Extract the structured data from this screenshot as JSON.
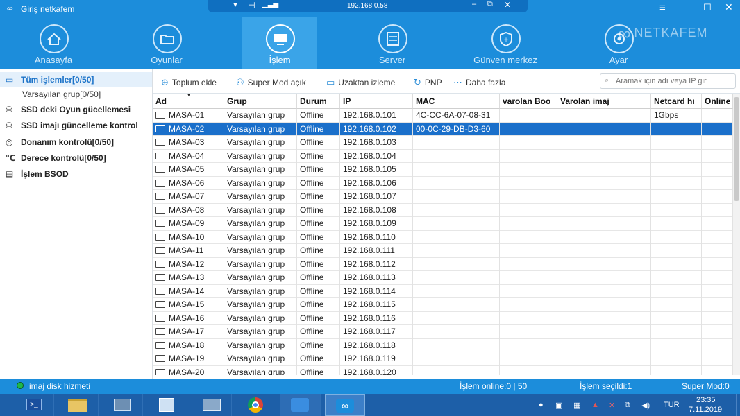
{
  "window": {
    "title": "Giriş netkafem",
    "ip_address": "192.168.0.58",
    "logo_text": "NETKAFEM"
  },
  "nav": [
    {
      "label": "Anasayfa",
      "icon": "home-icon"
    },
    {
      "label": "Oyunlar",
      "icon": "folder-icon"
    },
    {
      "label": "İşlem",
      "icon": "monitor-icon",
      "active": true
    },
    {
      "label": "Server",
      "icon": "server-icon"
    },
    {
      "label": "Günven merkez",
      "icon": "shield-icon"
    },
    {
      "label": "Ayar",
      "icon": "gear-icon"
    }
  ],
  "toolbar": {
    "add": "Toplum ekle",
    "super": "Super Mod açık",
    "remote": "Uzaktan izleme",
    "pnp": "PNP",
    "more": "Daha fazla",
    "search_placeholder": "Aramak için adı veya IP gir"
  },
  "sidebar": [
    {
      "label": "Tüm işlemler[0/50]",
      "icon": "monitor-icon"
    },
    {
      "label": "Varsayılan grup[0/50]"
    },
    {
      "label": "SSD deki Oyun gücellemesi",
      "icon": "ssd-icon"
    },
    {
      "label": "SSD imajı güncelleme kontrol",
      "icon": "ssd-icon"
    },
    {
      "label": "Donanım kontrolü[0/50]",
      "icon": "hardware-icon"
    },
    {
      "label": "Derece kontrolü[0/50]",
      "icon": "temperature-icon"
    },
    {
      "label": "İşlem BSOD",
      "icon": "bsod-icon"
    }
  ],
  "table": {
    "columns": [
      "Ad",
      "Grup",
      "Durum",
      "IP",
      "MAC",
      "varolan Boo",
      "Varolan imaj",
      "Netcard hı",
      "Online"
    ],
    "rows": [
      {
        "name": "MASA-01",
        "group": "Varsayılan grup",
        "status": "Offline",
        "ip": "192.168.0.101",
        "mac": "4C-CC-6A-07-08-31",
        "netcard": "1Gbps"
      },
      {
        "name": "MASA-02",
        "group": "Varsayılan grup",
        "status": "Offline",
        "ip": "192.168.0.102",
        "mac": "00-0C-29-DB-D3-60",
        "netcard": ""
      },
      {
        "name": "MASA-03",
        "group": "Varsayılan grup",
        "status": "Offline",
        "ip": "192.168.0.103",
        "mac": "",
        "netcard": ""
      },
      {
        "name": "MASA-04",
        "group": "Varsayılan grup",
        "status": "Offline",
        "ip": "192.168.0.104",
        "mac": "",
        "netcard": ""
      },
      {
        "name": "MASA-05",
        "group": "Varsayılan grup",
        "status": "Offline",
        "ip": "192.168.0.105",
        "mac": "",
        "netcard": ""
      },
      {
        "name": "MASA-06",
        "group": "Varsayılan grup",
        "status": "Offline",
        "ip": "192.168.0.106",
        "mac": "",
        "netcard": ""
      },
      {
        "name": "MASA-07",
        "group": "Varsayılan grup",
        "status": "Offline",
        "ip": "192.168.0.107",
        "mac": "",
        "netcard": ""
      },
      {
        "name": "MASA-08",
        "group": "Varsayılan grup",
        "status": "Offline",
        "ip": "192.168.0.108",
        "mac": "",
        "netcard": ""
      },
      {
        "name": "MASA-09",
        "group": "Varsayılan grup",
        "status": "Offline",
        "ip": "192.168.0.109",
        "mac": "",
        "netcard": ""
      },
      {
        "name": "MASA-10",
        "group": "Varsayılan grup",
        "status": "Offline",
        "ip": "192.168.0.110",
        "mac": "",
        "netcard": ""
      },
      {
        "name": "MASA-11",
        "group": "Varsayılan grup",
        "status": "Offline",
        "ip": "192.168.0.111",
        "mac": "",
        "netcard": ""
      },
      {
        "name": "MASA-12",
        "group": "Varsayılan grup",
        "status": "Offline",
        "ip": "192.168.0.112",
        "mac": "",
        "netcard": ""
      },
      {
        "name": "MASA-13",
        "group": "Varsayılan grup",
        "status": "Offline",
        "ip": "192.168.0.113",
        "mac": "",
        "netcard": ""
      },
      {
        "name": "MASA-14",
        "group": "Varsayılan grup",
        "status": "Offline",
        "ip": "192.168.0.114",
        "mac": "",
        "netcard": ""
      },
      {
        "name": "MASA-15",
        "group": "Varsayılan grup",
        "status": "Offline",
        "ip": "192.168.0.115",
        "mac": "",
        "netcard": ""
      },
      {
        "name": "MASA-16",
        "group": "Varsayılan grup",
        "status": "Offline",
        "ip": "192.168.0.116",
        "mac": "",
        "netcard": ""
      },
      {
        "name": "MASA-17",
        "group": "Varsayılan grup",
        "status": "Offline",
        "ip": "192.168.0.117",
        "mac": "",
        "netcard": ""
      },
      {
        "name": "MASA-18",
        "group": "Varsayılan grup",
        "status": "Offline",
        "ip": "192.168.0.118",
        "mac": "",
        "netcard": ""
      },
      {
        "name": "MASA-19",
        "group": "Varsayılan grup",
        "status": "Offline",
        "ip": "192.168.0.119",
        "mac": "",
        "netcard": ""
      },
      {
        "name": "MASA-20",
        "group": "Varsayılan grup",
        "status": "Offline",
        "ip": "192.168.0.120",
        "mac": "",
        "netcard": ""
      }
    ]
  },
  "status": {
    "service": "imaj disk hizmeti",
    "online": "İşlem online:0 | 50",
    "selected": "İşlem seçildi:1",
    "supermode": "Super Mod:0"
  },
  "taskbar": {
    "lang": "TUR",
    "time": "23:35",
    "date": "7.11.2019"
  },
  "colors": {
    "primary": "#1c8ddb",
    "active_tab": "#3aa4e8",
    "selected_row": "#1a6fca",
    "taskbar": "#1d5fa8"
  }
}
